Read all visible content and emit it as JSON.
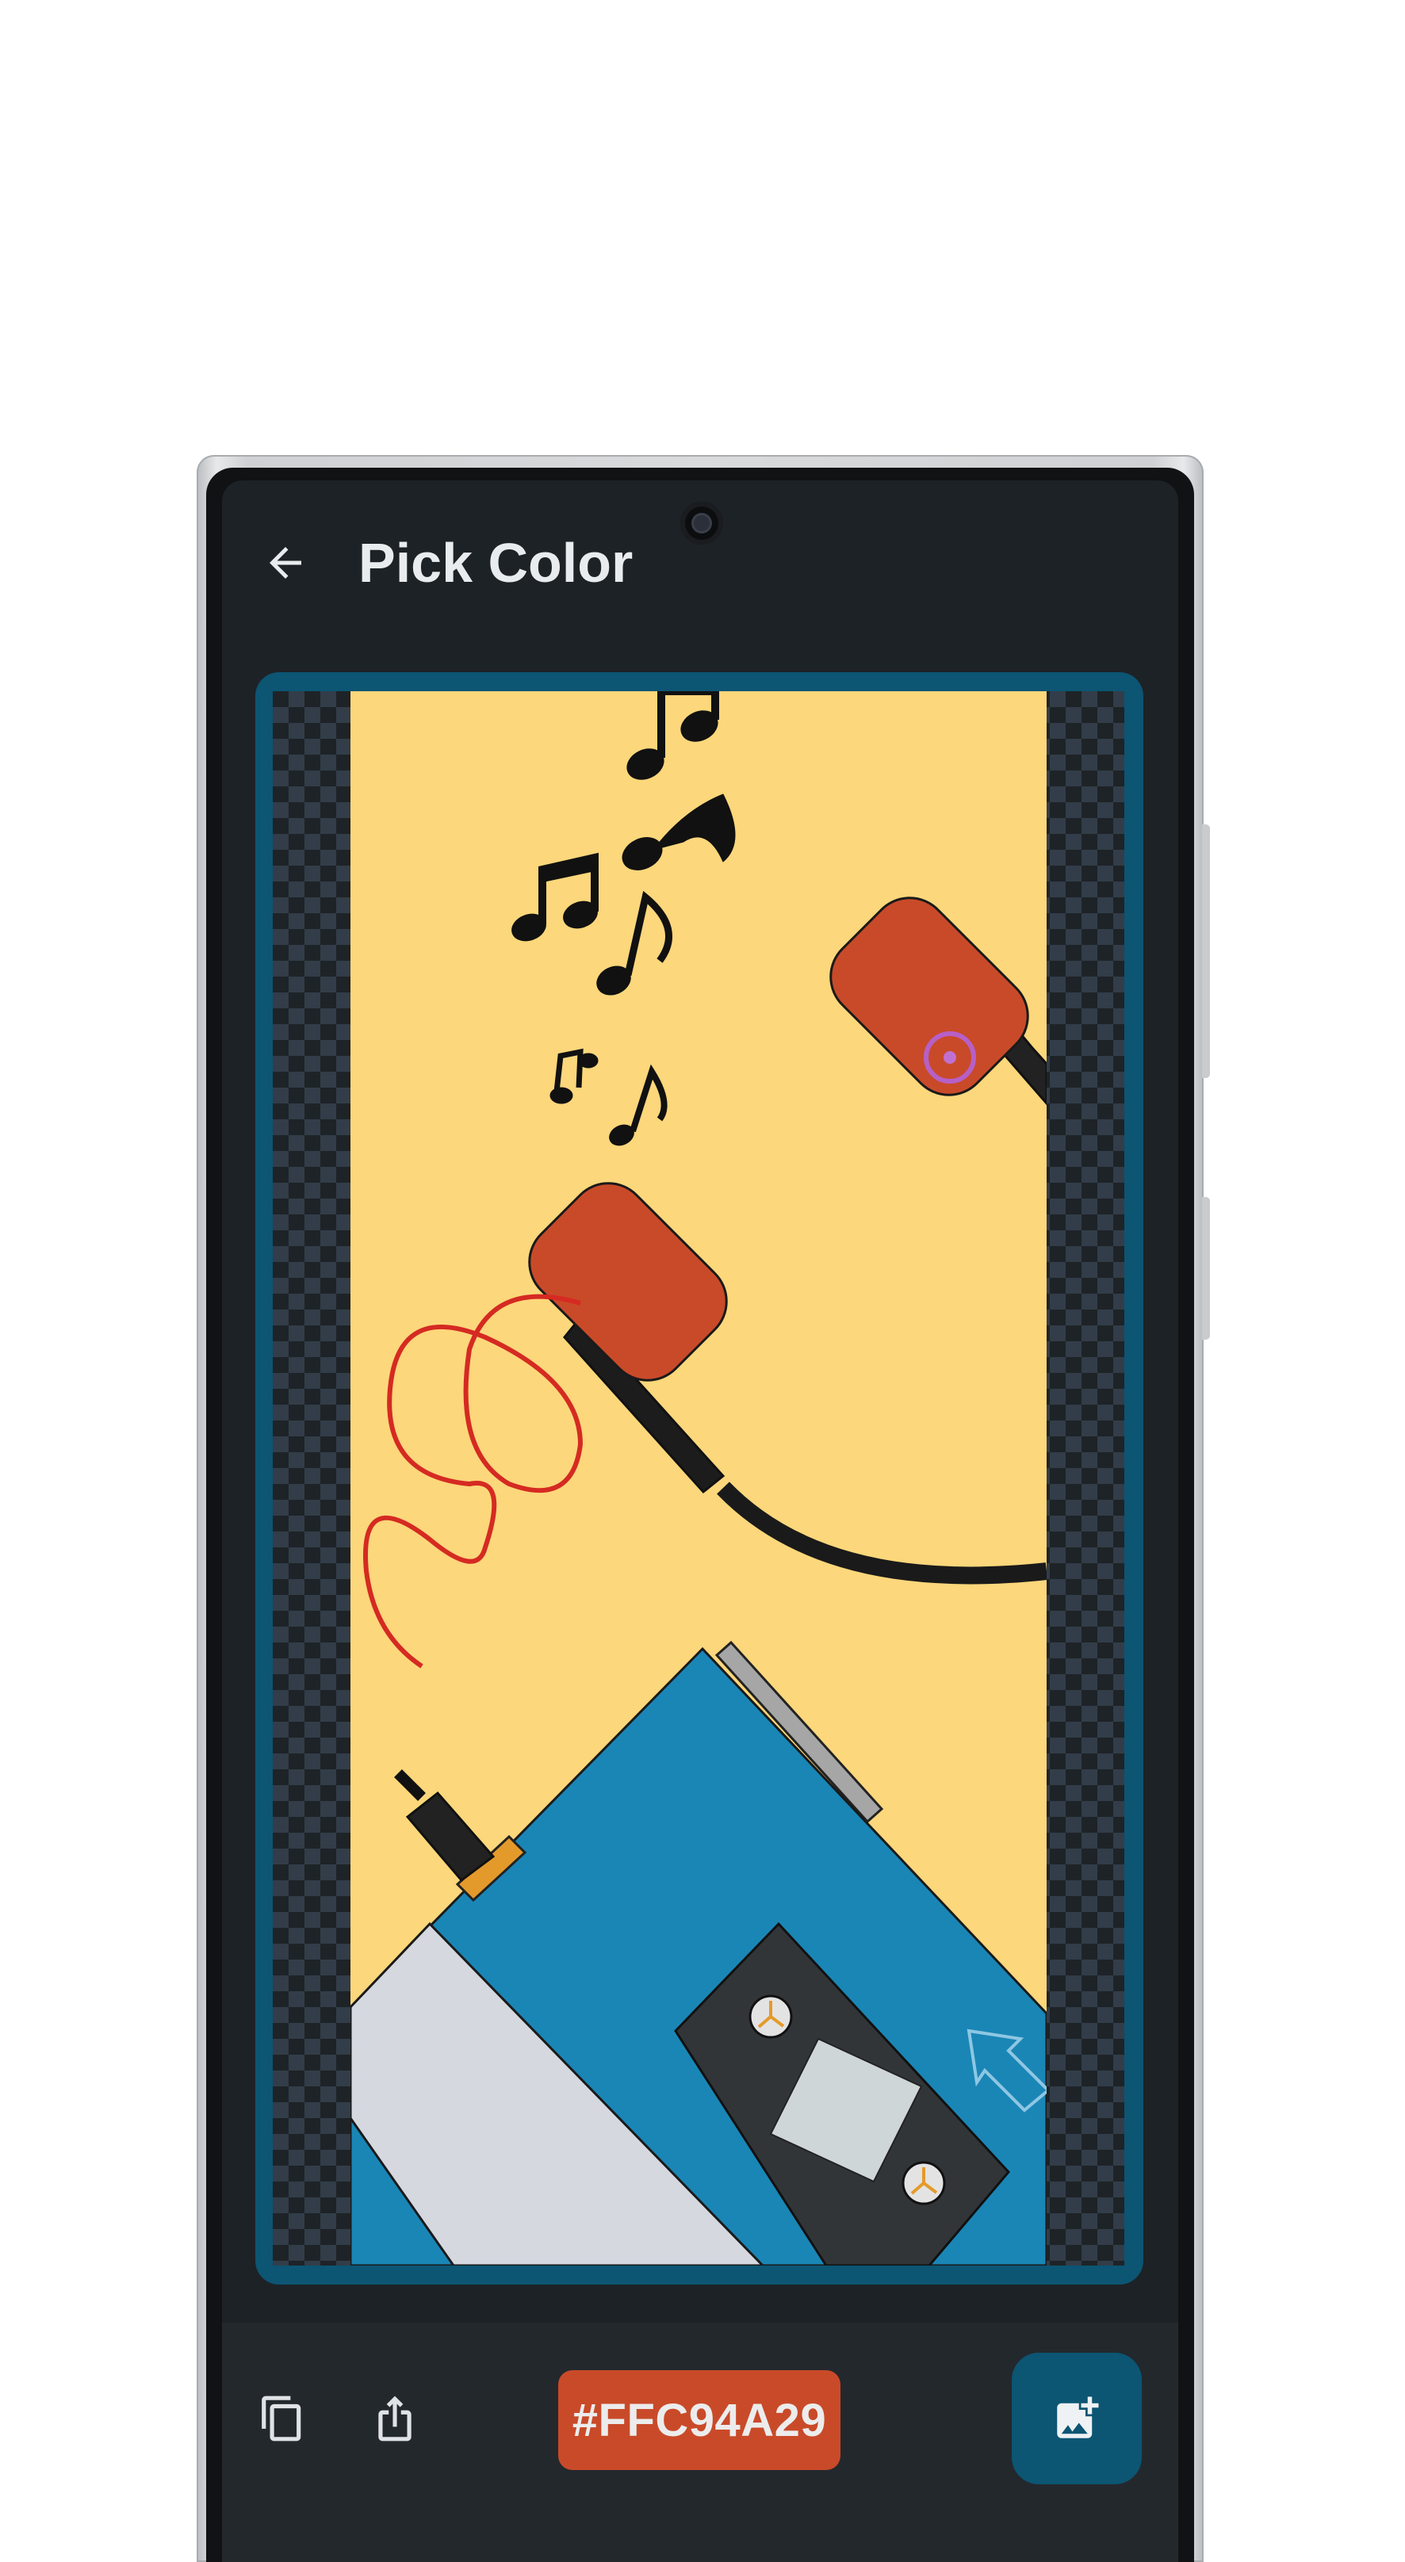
{
  "header": {
    "title": "Pick Color",
    "back_icon": "arrow-left-icon"
  },
  "picker": {
    "selected_color": "#FFC94A29",
    "chip_color": "#c94a29",
    "crosshair_icon": "target-crosshair-icon",
    "cursor_icon": "pointer-arrow-icon"
  },
  "image": {
    "background_color": "#fcd77b",
    "description_icons": [
      "music-notes",
      "headphones",
      "cassette-player"
    ]
  },
  "toolbar": {
    "copy_icon": "copy-icon",
    "share_icon": "share-icon",
    "pick_image_icon": "add-image-icon"
  },
  "colors": {
    "accent": "#0c5573",
    "background": "#1d2226",
    "bar": "#23282d"
  }
}
